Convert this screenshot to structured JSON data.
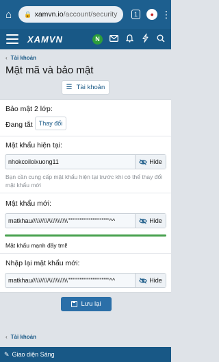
{
  "browser": {
    "url_host": "xamvn.io",
    "url_path": "/account/security",
    "tabs_count": "1",
    "home_icon": "home-icon",
    "lock_icon": "lock-icon",
    "menu_icon": "more-vert-icon"
  },
  "header": {
    "logo": "XAMVN",
    "avatar_letter": "N",
    "icons": [
      "envelope-icon",
      "bell-icon",
      "bolt-icon",
      "search-icon"
    ]
  },
  "breadcrumb": {
    "label": "Tài khoản"
  },
  "page": {
    "title": "Mật mã và bảo mật"
  },
  "nav_button": {
    "label": "Tài khoản"
  },
  "two_factor": {
    "label": "Bảo mật 2 lớp:",
    "status": "Đang tắt",
    "change_label": "Thay đổi"
  },
  "current_password": {
    "label": "Mật khẩu hiện tại:",
    "value": "nhokcoiloixuong11",
    "toggle": "Hide",
    "hint": "Bạn cần cung cấp mật khẩu hiện tại trước khi có thể thay đổi mật khẩu mới"
  },
  "new_password": {
    "label": "Mật khẩu mới:",
    "value": "matkhau//////////\\\\\\\\\\\\\\\\\\\\\\\"\"\"\"\"\"\"\"\"\"\"\"\"\"\"\"\"\"\"^^",
    "toggle": "Hide",
    "strength_text": "Mật khẩu mạnh đấy tml!",
    "strength_level": 1.0,
    "strength_color": "#47a04d"
  },
  "confirm_password": {
    "label": "Nhập lại mật khẩu mới:",
    "value": "matkhau//////////\\\\\\\\\\\\\\\\\\\\\\\"\"\"\"\"\"\"\"\"\"\"\"\"\"\"\"\"\"\"^^",
    "toggle": "Hide"
  },
  "save_button": {
    "label": "Lưu lại"
  },
  "footer": {
    "style_label": "Giao diện Sáng"
  },
  "colors": {
    "header": "#185886",
    "browser_bar": "#1d5f8f",
    "primary_button": "#2b6fa8"
  }
}
